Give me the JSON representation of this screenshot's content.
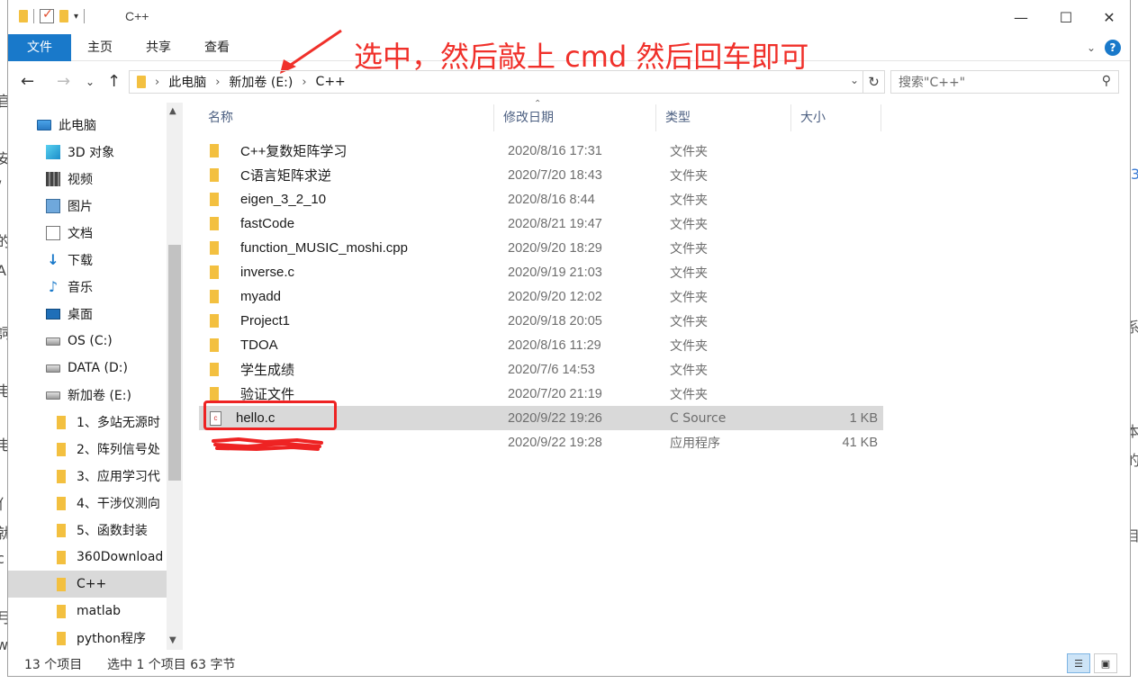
{
  "window": {
    "title": "C++"
  },
  "ribbon": {
    "tabs": [
      "文件",
      "主页",
      "共享",
      "查看"
    ]
  },
  "annotation": "选中，然后敲上 cmd 然后回车即可",
  "address": {
    "crumbs": [
      "此电脑",
      "新加卷 (E:)",
      "C++"
    ]
  },
  "search": {
    "placeholder": "搜索\"C++\""
  },
  "nav": {
    "items": [
      {
        "label": "此电脑",
        "icon": "computer-icon"
      },
      {
        "label": "3D 对象",
        "icon": "3d-objects-icon"
      },
      {
        "label": "视频",
        "icon": "video-icon"
      },
      {
        "label": "图片",
        "icon": "pictures-icon"
      },
      {
        "label": "文档",
        "icon": "documents-icon"
      },
      {
        "label": "下载",
        "icon": "download-icon"
      },
      {
        "label": "音乐",
        "icon": "music-icon"
      },
      {
        "label": "桌面",
        "icon": "desktop-icon"
      },
      {
        "label": "OS (C:)",
        "icon": "drive-icon"
      },
      {
        "label": "DATA (D:)",
        "icon": "drive-icon"
      },
      {
        "label": "新加卷 (E:)",
        "icon": "drive-icon"
      },
      {
        "label": "1、多站无源时",
        "icon": "folder-icon"
      },
      {
        "label": "2、阵列信号处",
        "icon": "folder-icon"
      },
      {
        "label": "3、应用学习代",
        "icon": "folder-icon"
      },
      {
        "label": "4、干涉仪测向",
        "icon": "folder-icon"
      },
      {
        "label": "5、函数封装",
        "icon": "folder-icon"
      },
      {
        "label": "360Download",
        "icon": "folder-icon"
      },
      {
        "label": "C++",
        "icon": "folder-icon"
      },
      {
        "label": "matlab",
        "icon": "folder-icon"
      },
      {
        "label": "python程序",
        "icon": "folder-icon"
      }
    ]
  },
  "columns": [
    "名称",
    "修改日期",
    "类型",
    "大小"
  ],
  "files": [
    {
      "name": "C++复数矩阵学习",
      "date": "2020/8/16 17:31",
      "type": "文件夹",
      "size": ""
    },
    {
      "name": "C语言矩阵求逆",
      "date": "2020/7/20 18:43",
      "type": "文件夹",
      "size": ""
    },
    {
      "name": "eigen_3_2_10",
      "date": "2020/8/16 8:44",
      "type": "文件夹",
      "size": ""
    },
    {
      "name": "fastCode",
      "date": "2020/8/21 19:47",
      "type": "文件夹",
      "size": ""
    },
    {
      "name": "function_MUSIC_moshi.cpp",
      "date": "2020/9/20 18:29",
      "type": "文件夹",
      "size": ""
    },
    {
      "name": "inverse.c",
      "date": "2020/9/19 21:03",
      "type": "文件夹",
      "size": ""
    },
    {
      "name": "myadd",
      "date": "2020/9/20 12:02",
      "type": "文件夹",
      "size": ""
    },
    {
      "name": "Project1",
      "date": "2020/9/18 20:05",
      "type": "文件夹",
      "size": ""
    },
    {
      "name": "TDOA",
      "date": "2020/8/16 11:29",
      "type": "文件夹",
      "size": ""
    },
    {
      "name": "学生成绩",
      "date": "2020/7/6 14:53",
      "type": "文件夹",
      "size": ""
    },
    {
      "name": "验证文件",
      "date": "2020/7/20 21:19",
      "type": "文件夹",
      "size": ""
    },
    {
      "name": "hello.c",
      "date": "2020/9/22 19:26",
      "type": "C Source",
      "size": "1 KB"
    },
    {
      "name": "",
      "date": "2020/9/22 19:28",
      "type": "应用程序",
      "size": "41 KB"
    }
  ],
  "status": {
    "count": "13 个项目",
    "selection": "选中 1 个项目  63 字节"
  },
  "colors": {
    "accent": "#1979ca",
    "annotation": "#f0302a",
    "selection": "#d9d9d9"
  }
}
